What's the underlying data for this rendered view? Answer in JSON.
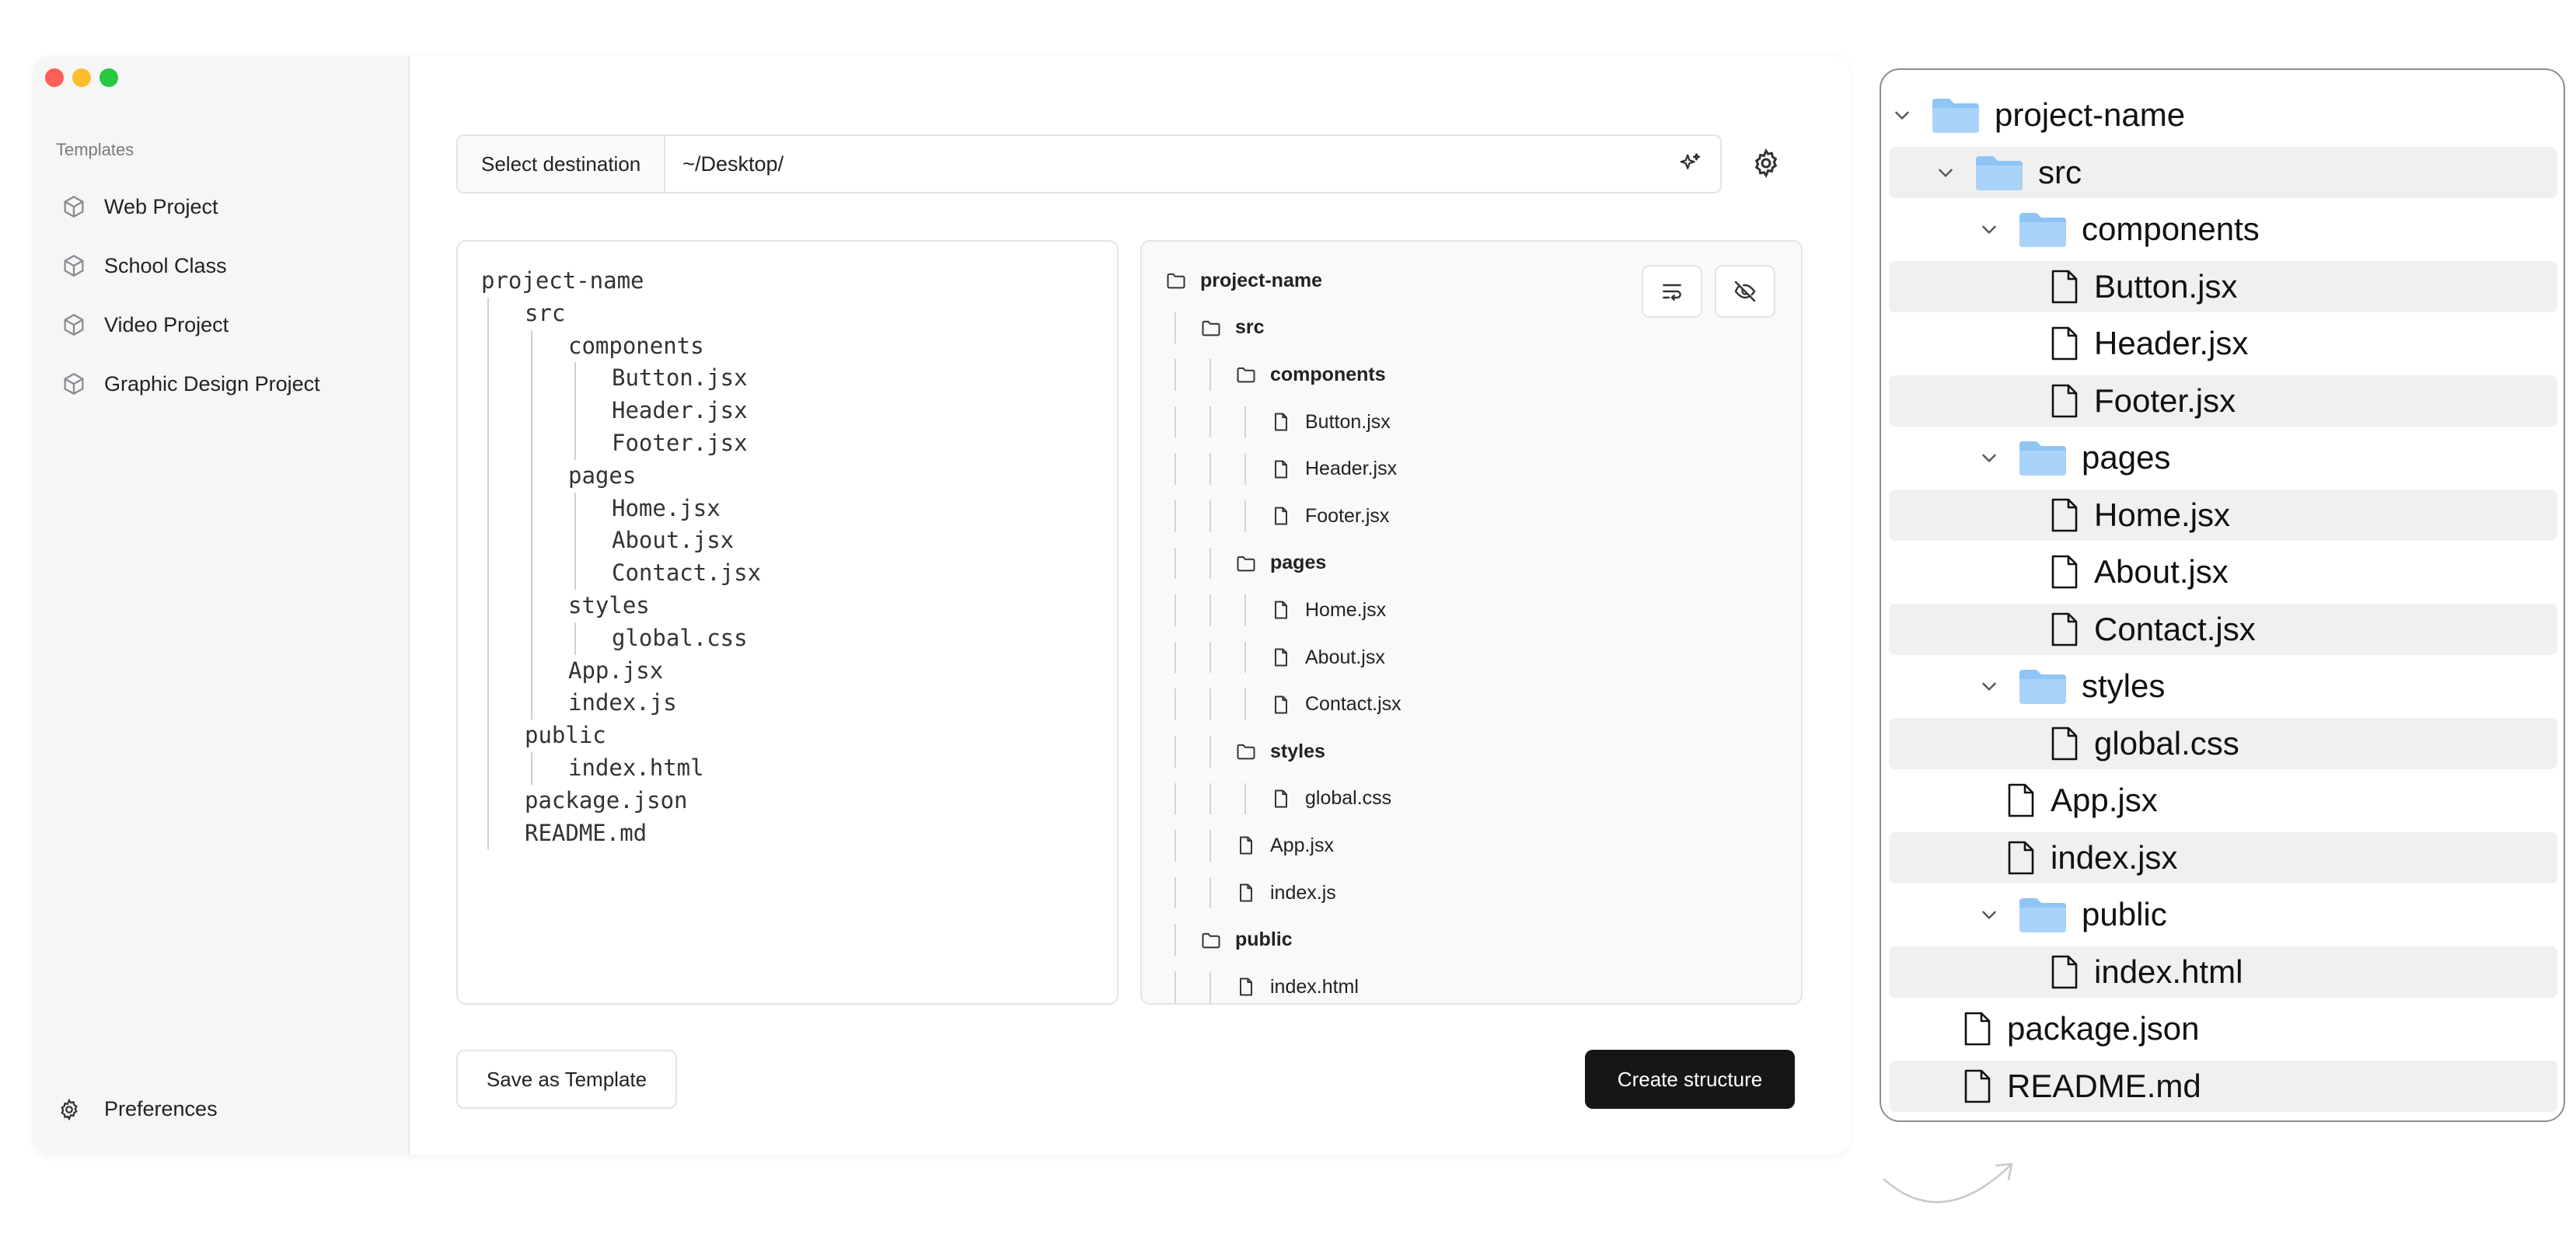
{
  "sidebar": {
    "heading": "Templates",
    "items": [
      {
        "label": "Web Project",
        "icon": "cube-icon"
      },
      {
        "label": "School Class",
        "icon": "cube-icon"
      },
      {
        "label": "Video Project",
        "icon": "cube-icon"
      },
      {
        "label": "Graphic Design Project",
        "icon": "cube-icon"
      }
    ],
    "preferences_label": "Preferences"
  },
  "destination": {
    "button_label": "Select destination",
    "path": "~/Desktop/"
  },
  "editor": {
    "lines": [
      {
        "depth": 0,
        "text": "project-name"
      },
      {
        "depth": 1,
        "text": "src"
      },
      {
        "depth": 2,
        "text": "components"
      },
      {
        "depth": 3,
        "text": "Button.jsx"
      },
      {
        "depth": 3,
        "text": "Header.jsx"
      },
      {
        "depth": 3,
        "text": "Footer.jsx"
      },
      {
        "depth": 2,
        "text": "pages"
      },
      {
        "depth": 3,
        "text": "Home.jsx"
      },
      {
        "depth": 3,
        "text": "About.jsx"
      },
      {
        "depth": 3,
        "text": "Contact.jsx"
      },
      {
        "depth": 2,
        "text": "styles"
      },
      {
        "depth": 3,
        "text": "global.css"
      },
      {
        "depth": 2,
        "text": "App.jsx"
      },
      {
        "depth": 2,
        "text": "index.js"
      },
      {
        "depth": 1,
        "text": "public"
      },
      {
        "depth": 2,
        "text": "index.html"
      },
      {
        "depth": 1,
        "text": "package.json"
      },
      {
        "depth": 1,
        "text": "README.md"
      }
    ]
  },
  "preview": {
    "rows": [
      {
        "depth": 0,
        "type": "folder",
        "name": "project-name"
      },
      {
        "depth": 1,
        "type": "folder",
        "name": "src"
      },
      {
        "depth": 2,
        "type": "folder",
        "name": "components"
      },
      {
        "depth": 3,
        "type": "file",
        "name": "Button.jsx"
      },
      {
        "depth": 3,
        "type": "file",
        "name": "Header.jsx"
      },
      {
        "depth": 3,
        "type": "file",
        "name": "Footer.jsx"
      },
      {
        "depth": 2,
        "type": "folder",
        "name": "pages"
      },
      {
        "depth": 3,
        "type": "file",
        "name": "Home.jsx"
      },
      {
        "depth": 3,
        "type": "file",
        "name": "About.jsx"
      },
      {
        "depth": 3,
        "type": "file",
        "name": "Contact.jsx"
      },
      {
        "depth": 2,
        "type": "folder",
        "name": "styles"
      },
      {
        "depth": 3,
        "type": "file",
        "name": "global.css"
      },
      {
        "depth": 2,
        "type": "file",
        "name": "App.jsx"
      },
      {
        "depth": 2,
        "type": "file",
        "name": "index.js"
      },
      {
        "depth": 1,
        "type": "folder",
        "name": "public"
      },
      {
        "depth": 2,
        "type": "file",
        "name": "index.html"
      }
    ],
    "toolbar_icons": [
      "wrap-lines-icon",
      "eye-off-icon"
    ]
  },
  "actions": {
    "save_template": "Save as Template",
    "create_structure": "Create structure"
  },
  "big_tree": {
    "rows": [
      {
        "depth": 0,
        "type": "folder",
        "name": "project-name"
      },
      {
        "depth": 1,
        "type": "folder",
        "name": "src"
      },
      {
        "depth": 2,
        "type": "folder",
        "name": "components"
      },
      {
        "depth": 3,
        "type": "file",
        "name": "Button.jsx"
      },
      {
        "depth": 3,
        "type": "file",
        "name": "Header.jsx"
      },
      {
        "depth": 3,
        "type": "file",
        "name": "Footer.jsx"
      },
      {
        "depth": 2,
        "type": "folder",
        "name": "pages"
      },
      {
        "depth": 3,
        "type": "file",
        "name": "Home.jsx"
      },
      {
        "depth": 3,
        "type": "file",
        "name": "About.jsx"
      },
      {
        "depth": 3,
        "type": "file",
        "name": "Contact.jsx"
      },
      {
        "depth": 2,
        "type": "folder",
        "name": "styles"
      },
      {
        "depth": 3,
        "type": "file",
        "name": "global.css"
      },
      {
        "depth": 2,
        "type": "file",
        "name": "App.jsx"
      },
      {
        "depth": 2,
        "type": "file",
        "name": "index.jsx"
      },
      {
        "depth": 2,
        "type": "folder",
        "name": "public"
      },
      {
        "depth": 3,
        "type": "file",
        "name": "index.html"
      },
      {
        "depth": 1,
        "type": "file",
        "name": "package.json"
      },
      {
        "depth": 1,
        "type": "file",
        "name": "README.md"
      }
    ],
    "folder_color": "#8ec5f5"
  },
  "colors": {
    "create_button": "#161616",
    "traffic_red": "#fe5f57",
    "traffic_yellow": "#febc2e",
    "traffic_green": "#28c840"
  }
}
